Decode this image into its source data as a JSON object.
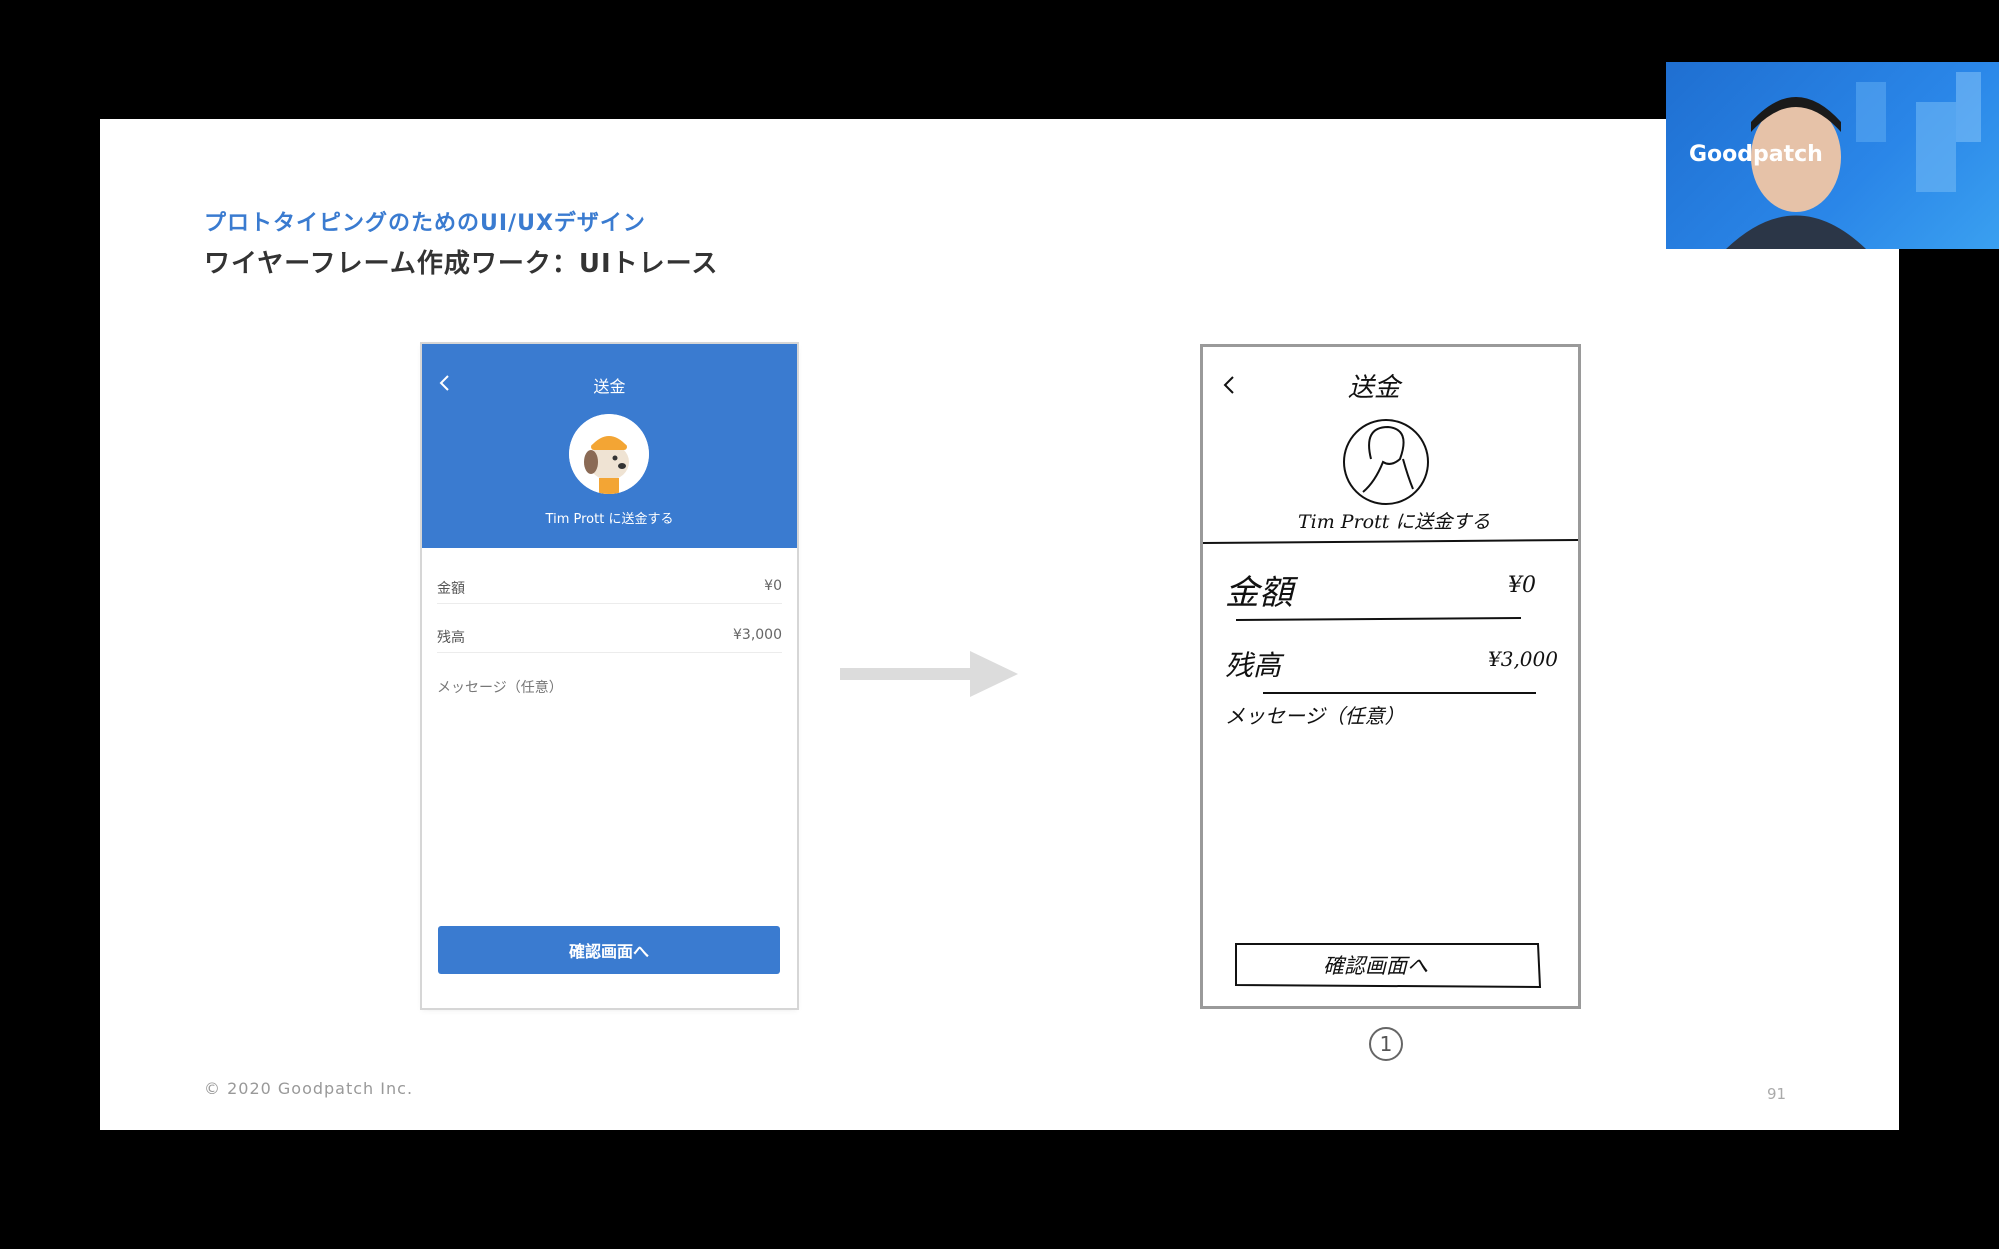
{
  "slide": {
    "subtitle": "プロトタイピングのためのUI/UXデザイン",
    "title": "ワイヤーフレーム作成ワーク：UIトレース",
    "copyright": "© 2020 Goodpatch Inc.",
    "page_number": "91"
  },
  "phone": {
    "header_title": "送金",
    "recipient_text": "Tim Prott に送金する",
    "amount_label": "金額",
    "amount_value": "¥0",
    "balance_label": "残高",
    "balance_value": "¥3,000",
    "message_label": "メッセージ（任意）",
    "confirm_button": "確認画面へ",
    "colors": {
      "primary": "#3a7bd0"
    }
  },
  "sketch": {
    "title": "送金",
    "recipient_text": "Tim Prott に送金する",
    "amount_label": "金額",
    "amount_value": "¥0",
    "balance_label": "残高",
    "balance_value": "¥3,000",
    "message_label": "メッセージ（任意）",
    "confirm_button": "確認画面へ",
    "number": "1"
  },
  "video": {
    "logo_text": "Goodpatch"
  }
}
